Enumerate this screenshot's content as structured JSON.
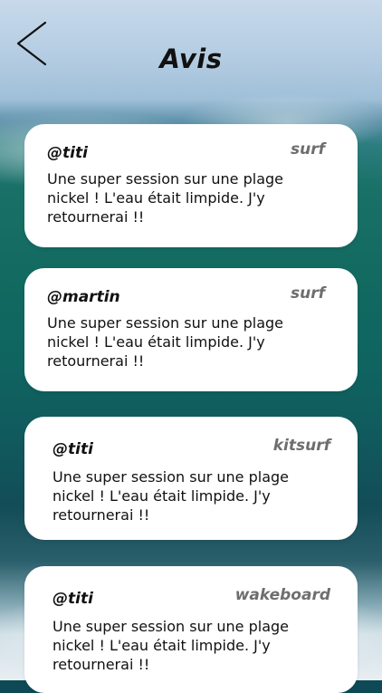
{
  "header": {
    "title": "Avis"
  },
  "reviews": [
    {
      "user": "@titi",
      "sport": "surf",
      "text": "Une super session sur une plage nickel ! L'eau était limpide. J'y retournerai !!"
    },
    {
      "user": "@martin",
      "sport": "surf",
      "text": "Une super session sur une plage nickel ! L'eau était limpide. J'y retournerai !!"
    },
    {
      "user": "@titi",
      "sport": "kitsurf",
      "text": "Une super session sur une plage nickel ! L'eau était limpide. J'y retournerai !!"
    },
    {
      "user": "@titi",
      "sport": "wakeboard",
      "text": "Une super session sur une plage nickel ! L'eau était limpide. J'y retournerai !!"
    }
  ],
  "icons": {
    "back": "chevron-left-icon"
  }
}
